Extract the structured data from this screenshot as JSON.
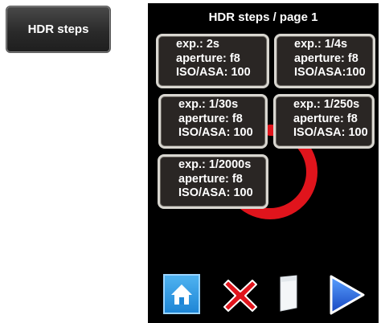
{
  "side_button": {
    "label": "HDR steps"
  },
  "screen": {
    "title": "HDR steps / page 1",
    "steps": [
      {
        "exposure": "exp.: 2s",
        "aperture": "aperture: f8",
        "iso": "ISO/ASA: 100"
      },
      {
        "exposure": "exp.: 1/4s",
        "aperture": "aperture: f8",
        "iso": "ISO/ASA:100"
      },
      {
        "exposure": "exp.: 1/30s",
        "aperture": "aperture: f8",
        "iso": "ISO/ASA: 100"
      },
      {
        "exposure": "exp.: 1/250s",
        "aperture": "aperture: f8",
        "iso": "ISO/ASA: 100"
      },
      {
        "exposure": "exp.: 1/2000s",
        "aperture": "aperture: f8",
        "iso": "ISO/ASA: 100"
      }
    ]
  },
  "toolbar": {
    "icons": [
      "home-icon",
      "close-icon",
      "page-icon",
      "next-arrow-icon"
    ],
    "colors": {
      "home": "#1e86d6",
      "close": "#e0141c",
      "next": "#1a5fd8",
      "ring": "#e0141c"
    }
  }
}
